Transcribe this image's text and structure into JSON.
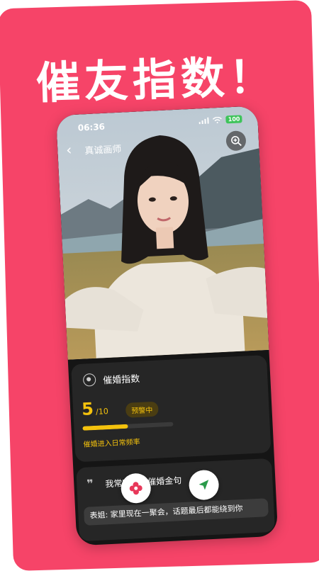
{
  "headline": "催友指数！",
  "status_bar": {
    "time": "06:36",
    "battery": "100"
  },
  "nav": {
    "title": "真诚画师"
  },
  "index_card": {
    "title": "催婚指数",
    "score": "5",
    "score_max": "/10",
    "badge": "预警中",
    "progress": 0.5,
    "status": "催婚进入日常频率"
  },
  "quote_card": {
    "quote_mark": "❞",
    "title": "我常听到的催婚金句",
    "message": "表姐: 家里现在一聚会，话题最后都能绕到你"
  },
  "colors": {
    "poster": "#f64468",
    "accent": "#f4c20d",
    "card": "#262626"
  }
}
